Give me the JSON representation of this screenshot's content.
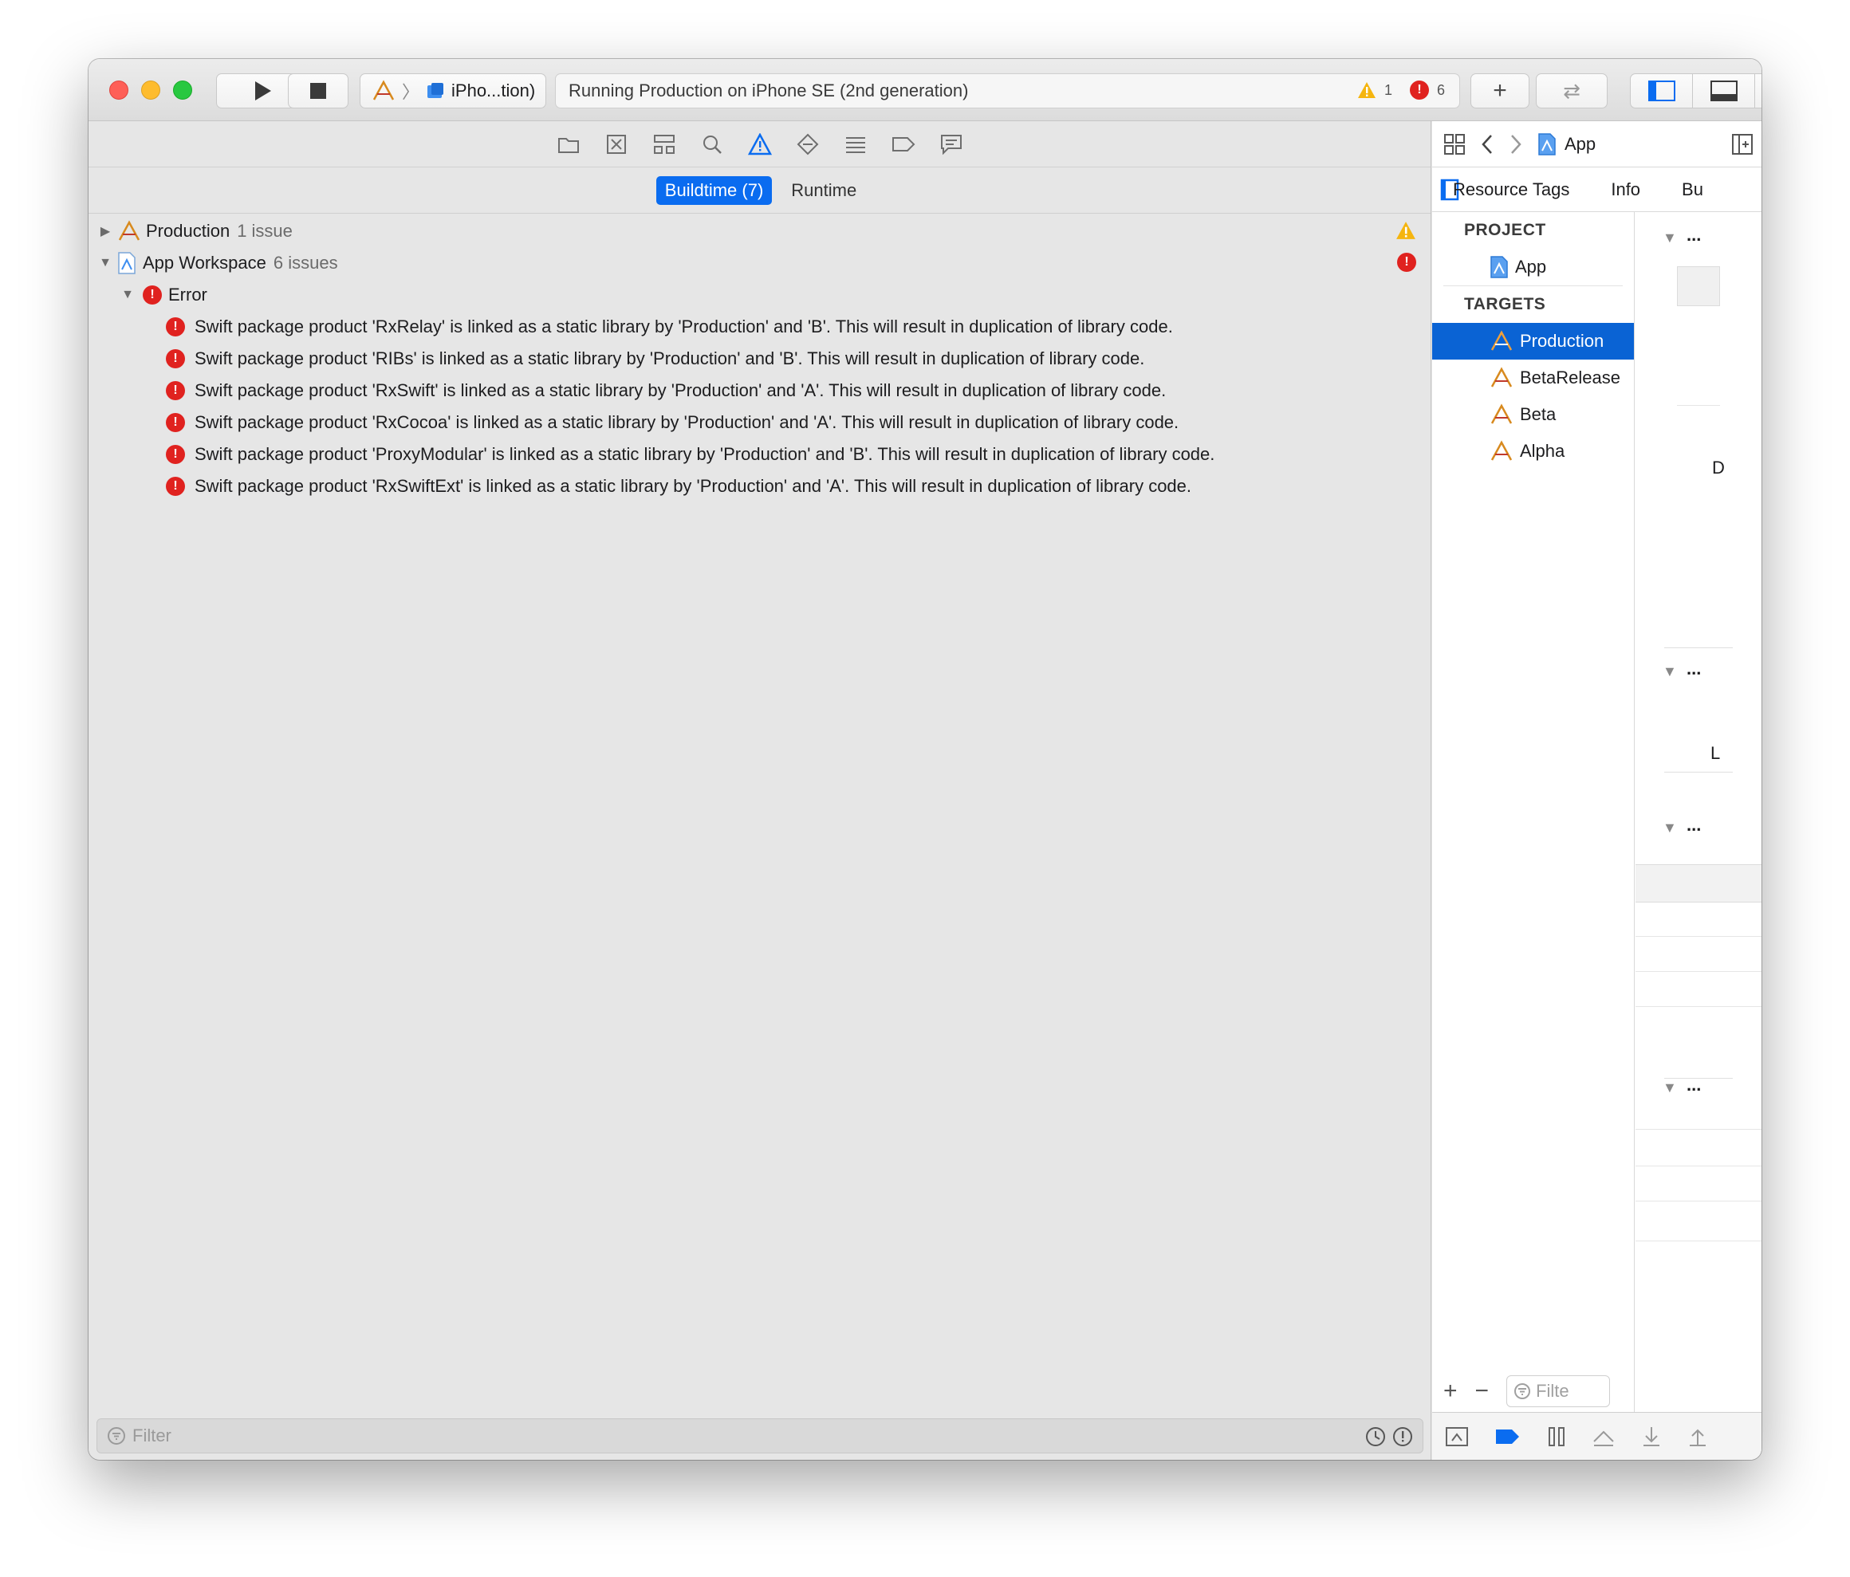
{
  "toolbar": {
    "scheme_label": "iPho...tion)",
    "status_text": "Running Production on iPhone SE (2nd generation)",
    "warning_count": "1",
    "error_count": "6",
    "add_label": "+",
    "swap_label": "⇄"
  },
  "navigator": {
    "scope_buildtime": "Buildtime (7)",
    "scope_runtime": "Runtime",
    "groups": [
      {
        "title": "Production",
        "count": "1 issue"
      },
      {
        "title": "App Workspace",
        "count": "6 issues"
      }
    ],
    "category": "Error",
    "issues": [
      "Swift package product 'RxRelay' is linked as a static library by 'Production' and 'B'. This will result in duplication of library code.",
      "Swift package product 'RIBs' is linked as a static library by 'Production' and 'B'. This will result in duplication of library code.",
      "Swift package product 'RxSwift' is linked as a static library by 'Production' and 'A'. This will result in duplication of library code.",
      "Swift package product 'RxCocoa' is linked as a static library by 'Production' and 'A'. This will result in duplication of library code.",
      "Swift package product 'ProxyModular' is linked as a static library by 'Production' and 'B'. This will result in duplication of library code.",
      "Swift package product 'RxSwiftExt' is linked as a static library by 'Production' and 'A'. This will result in duplication of library code."
    ],
    "filter_placeholder": "Filter"
  },
  "editor": {
    "jump_title": "App",
    "tabs": [
      "Resource Tags",
      "Info",
      "Bu"
    ],
    "project_header": "PROJECT",
    "project_item": "App",
    "targets_header": "TARGETS",
    "targets": [
      "Production",
      "BetaRelease",
      "Beta",
      "Alpha"
    ],
    "list_filter_placeholder": "Filte",
    "ellipsis": "...",
    "stray_letter_1": "D",
    "stray_letter_2": "L"
  },
  "colors": {
    "accent": "#0a6cf0",
    "selection": "#0a63d4",
    "error": "#e0221f",
    "warning": "#f5b50f"
  }
}
